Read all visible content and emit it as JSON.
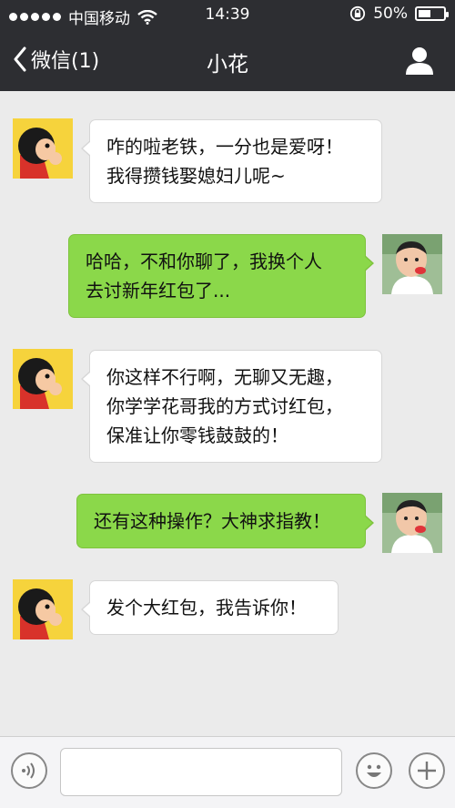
{
  "status_bar": {
    "carrier": "中国移动",
    "time": "14:39",
    "battery_text": "50%",
    "battery_level": 0.5,
    "signal_bars": 5,
    "icons": [
      "signal-dots-icon",
      "wifi-icon",
      "rotation-lock-icon",
      "battery-icon"
    ]
  },
  "nav": {
    "back_label": "微信(1)",
    "title": "小花",
    "icons": [
      "chevron-left-icon",
      "user-profile-icon"
    ]
  },
  "messages": [
    {
      "side": "in",
      "avatar": "cartoon-avatar",
      "lines": [
        "咋的啦老铁，一分也是爱呀！",
        "我得攒钱娶媳妇儿呢~"
      ]
    },
    {
      "side": "out",
      "avatar": "boy-photo-avatar",
      "lines": [
        "哈哈，不和你聊了，我换个人",
        "去讨新年红包了..."
      ]
    },
    {
      "side": "in",
      "avatar": "cartoon-avatar",
      "lines": [
        "你这样不行啊，无聊又无趣，",
        "你学学花哥我的方式讨红包，",
        "保准让你零钱鼓鼓的！"
      ]
    },
    {
      "side": "out",
      "avatar": "boy-photo-avatar",
      "lines": [
        "还有这种操作？大神求指教！"
      ]
    },
    {
      "side": "in",
      "avatar": "cartoon-avatar",
      "lines": [
        "发个大红包，我告诉你！"
      ]
    }
  ],
  "input_bar": {
    "text_value": "",
    "icons": [
      "voice-icon",
      "emoji-icon",
      "plus-icon"
    ]
  },
  "colors": {
    "bar_bg": "#2d2e32",
    "chat_bg": "#ebebeb",
    "outgoing_bubble": "#8bd84a",
    "incoming_bubble": "#ffffff"
  }
}
